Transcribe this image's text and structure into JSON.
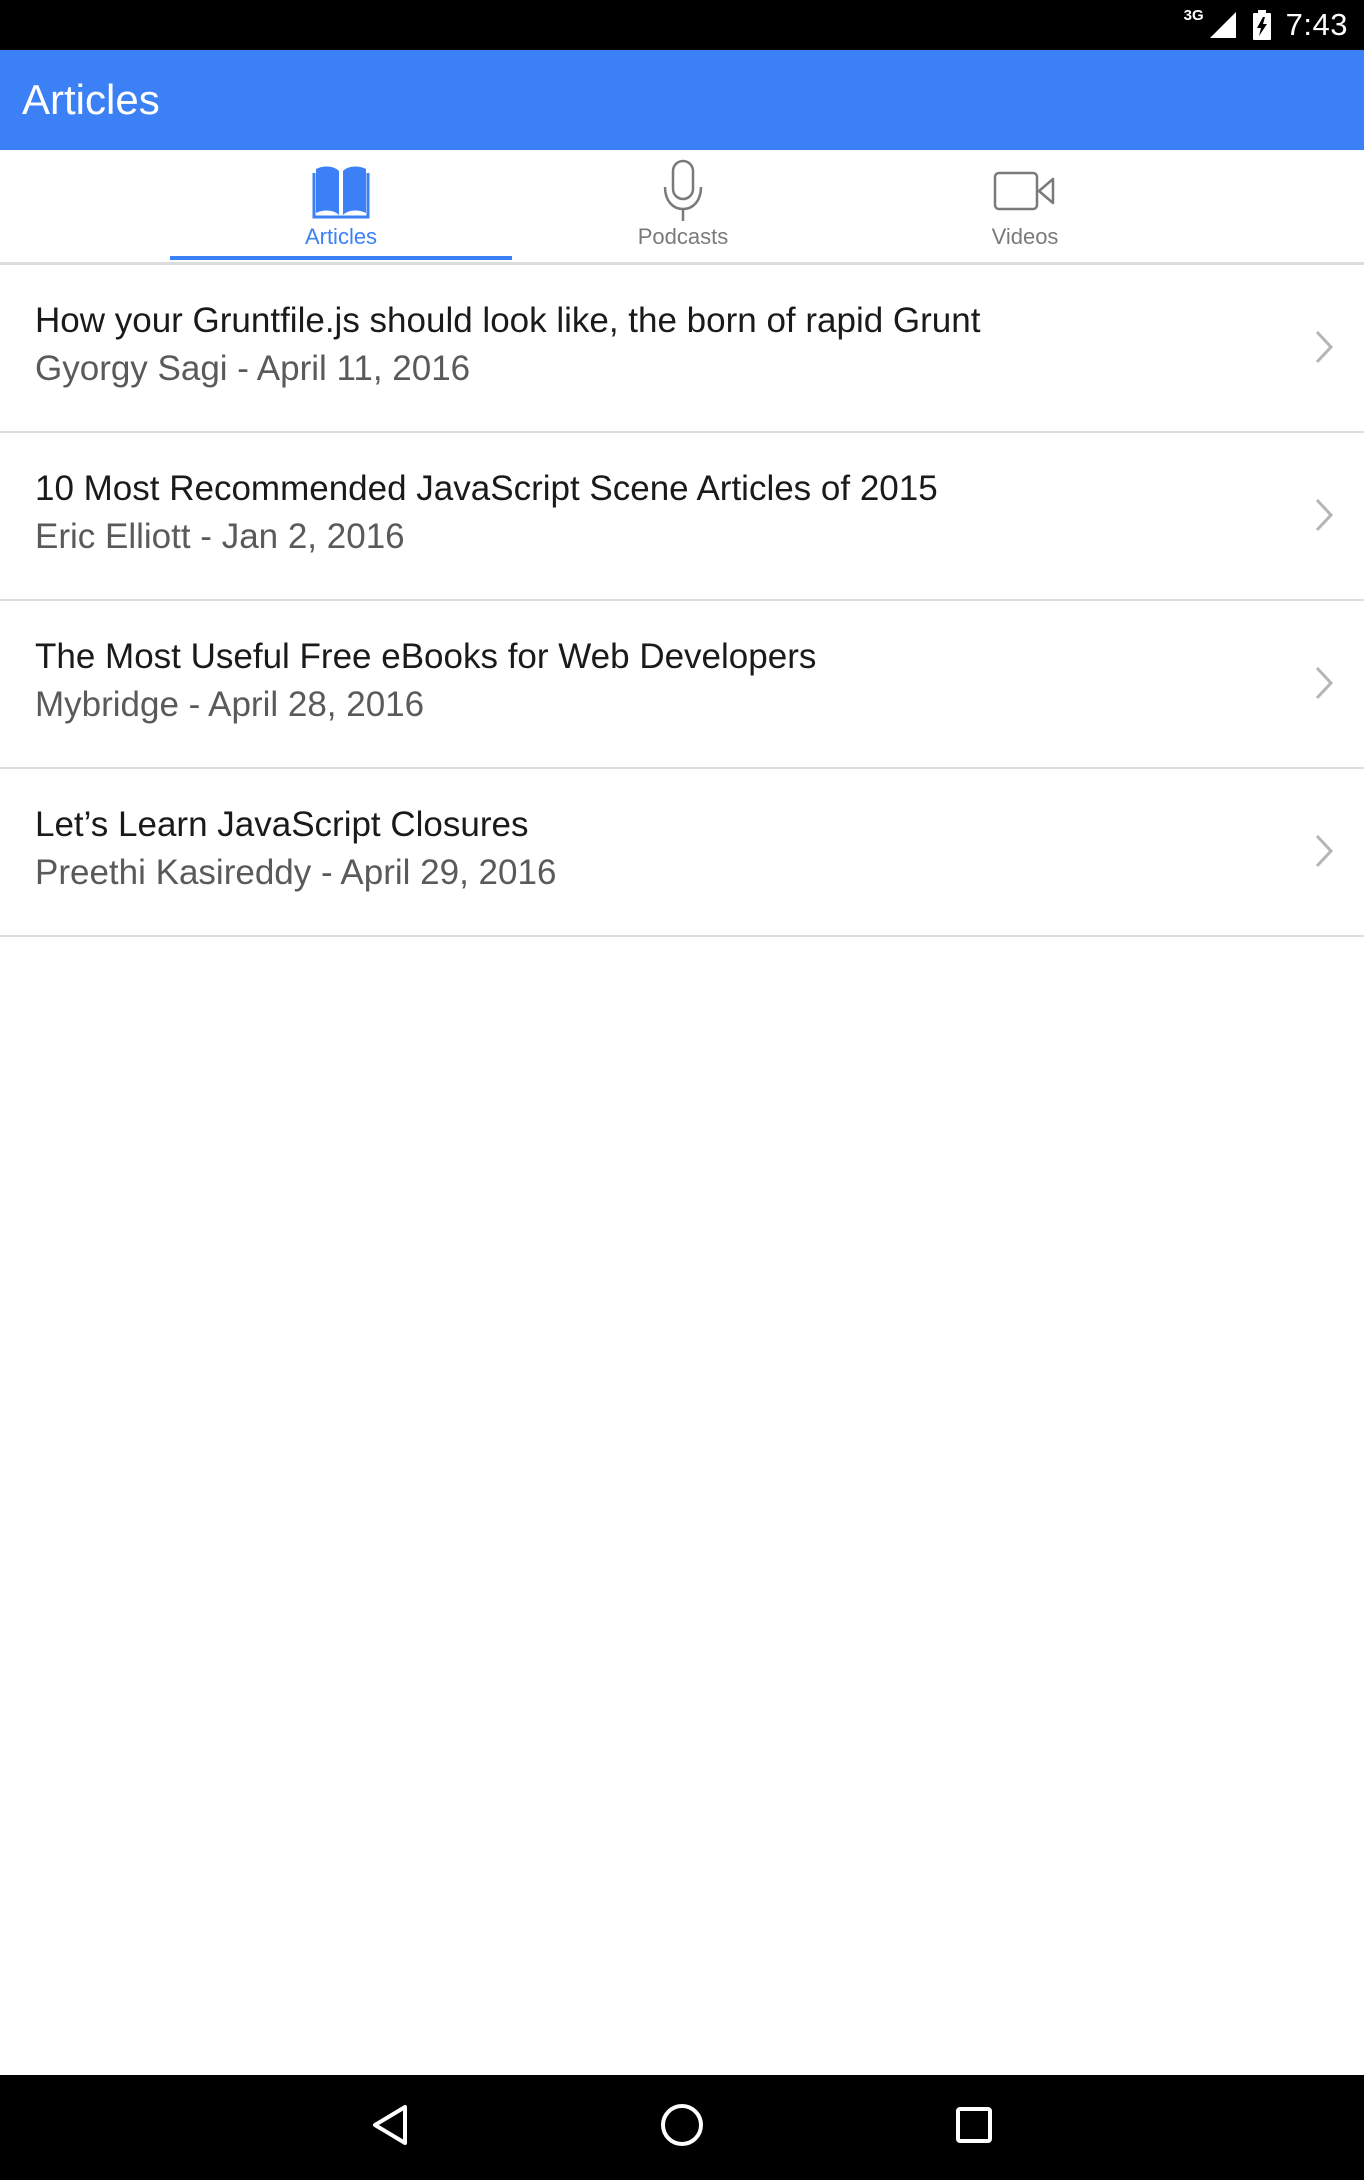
{
  "status_bar": {
    "network": "3G",
    "time": "7:43"
  },
  "app_bar": {
    "title": "Articles"
  },
  "tabs": [
    {
      "label": "Articles",
      "icon": "book-icon",
      "active": true
    },
    {
      "label": "Podcasts",
      "icon": "microphone-icon",
      "active": false
    },
    {
      "label": "Videos",
      "icon": "video-camera-icon",
      "active": false
    }
  ],
  "articles": [
    {
      "title": "How your Gruntfile.js should look like, the born of rapid Grunt",
      "meta": "Gyorgy Sagi - April 11, 2016"
    },
    {
      "title": "10 Most Recommended JavaScript Scene Articles of 2015",
      "meta": "Eric Elliott - Jan 2, 2016"
    },
    {
      "title": "The Most Useful Free eBooks for Web Developers",
      "meta": "Mybridge - April 28, 2016"
    },
    {
      "title": "Let’s Learn JavaScript Closures",
      "meta": "Preethi Kasireddy - April 29, 2016"
    }
  ],
  "nav_bar": {
    "buttons": [
      "back-icon",
      "home-icon",
      "recents-icon"
    ]
  },
  "colors": {
    "accent": "#3b80f4",
    "inactive_tab": "#7a7a7a",
    "divider": "#dedede"
  }
}
